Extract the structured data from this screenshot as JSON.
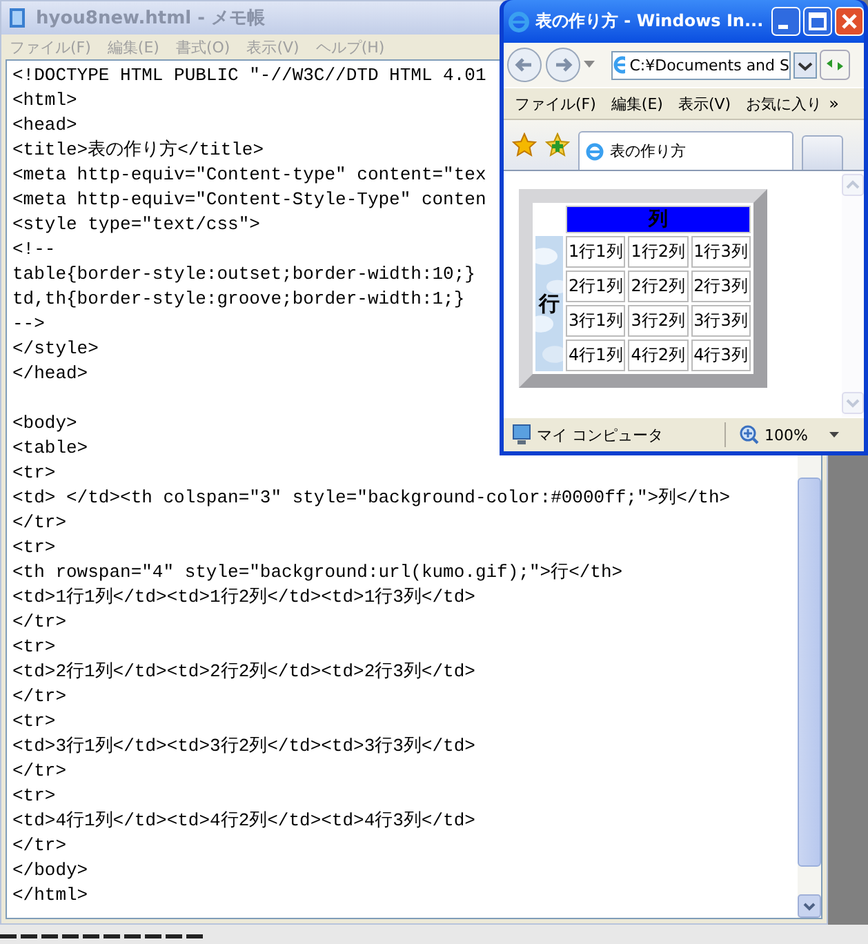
{
  "notepad": {
    "title": "hyou8new.html - メモ帳",
    "menu": [
      "ファイル(F)",
      "編集(E)",
      "書式(O)",
      "表示(V)",
      "ヘルプ(H)"
    ],
    "paragraphs": [
      [
        "<!DOCTYPE HTML PUBLIC \"-//W3C//DTD HTML 4.01",
        "<html>",
        "<head>",
        "<title>表の作り方</title>",
        "<meta http-equiv=\"Content-type\" content=\"tex",
        "<meta http-equiv=\"Content-Style-Type\" conten",
        "<style type=\"text/css\">",
        "<!--",
        "table{border-style:outset;border-width:10;}",
        "td,th{border-style:groove;border-width:1;}",
        "-->",
        "</style>",
        "</head>"
      ],
      [
        "<body>",
        "<table>",
        "<tr>",
        "<td> </td><th colspan=\"3\" style=\"background-color:#0000ff;\">列</th>",
        "</tr>",
        "<tr>",
        "<th rowspan=\"4\" style=\"background:url(kumo.gif);\">行</th>",
        "<td>1行1列</td><td>1行2列</td><td>1行3列</td>",
        "</tr>",
        "<tr>",
        "<td>2行1列</td><td>2行2列</td><td>2行3列</td>",
        "</tr>",
        "<tr>",
        "<td>3行1列</td><td>3行2列</td><td>3行3列</td>",
        "</tr>",
        "<tr>",
        "<td>4行1列</td><td>4行2列</td><td>4行3列</td>",
        "</tr>",
        "</body>",
        "</html>"
      ]
    ]
  },
  "browser": {
    "title": "表の作り方 - Windows In...",
    "address": "C:¥Documents and S",
    "menu": [
      "ファイル(F)",
      "編集(E)",
      "表示(V)",
      "お気に入り"
    ],
    "menu_more": "»",
    "tab": "表の作り方",
    "table": {
      "header": "列",
      "row_header": "行",
      "rows": [
        [
          "1行1列",
          "1行2列",
          "1行3列"
        ],
        [
          "2行1列",
          "2行2列",
          "2行3列"
        ],
        [
          "3行1列",
          "3行2列",
          "3行3列"
        ],
        [
          "4行1列",
          "4行2列",
          "4行3列"
        ]
      ]
    },
    "status": {
      "zone": "マイ コンピュータ",
      "zoom": "100%"
    }
  }
}
